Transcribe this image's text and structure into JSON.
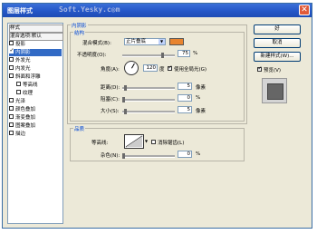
{
  "window": {
    "title": "图层样式",
    "watermark": "Soft.Yesky.c◎m",
    "close": "✕"
  },
  "left_panel": {
    "items": [
      {
        "label": "样式",
        "type": "header"
      },
      {
        "label": "混合选项:默认",
        "type": "header"
      },
      {
        "label": "投影",
        "checked": false
      },
      {
        "label": "内阴影",
        "checked": true,
        "selected": true
      },
      {
        "label": "外发光",
        "checked": false
      },
      {
        "label": "内发光",
        "checked": false
      },
      {
        "label": "斜面和浮雕",
        "checked": false
      },
      {
        "label": "等高线",
        "checked": false,
        "sub": true
      },
      {
        "label": "纹理",
        "checked": false,
        "sub": true
      },
      {
        "label": "光泽",
        "checked": false
      },
      {
        "label": "颜色叠加",
        "checked": false
      },
      {
        "label": "渐变叠加",
        "checked": false
      },
      {
        "label": "图案叠加",
        "checked": false
      },
      {
        "label": "描边",
        "checked": false
      }
    ]
  },
  "inner_shadow": {
    "section_title": "内阴影",
    "structure_title": "结构",
    "blend_mode_label": "混合模式(B):",
    "blend_mode_value": "正片叠底",
    "shadow_color": "#e8842f",
    "opacity_label": "不透明度(O):",
    "opacity_value": "75",
    "opacity_unit": "%",
    "angle_label": "角度(A):",
    "angle_value": "120",
    "angle_unit": "度",
    "global_light_label": "使用全局光(G)",
    "global_light_checked": true,
    "distance_label": "距离(D):",
    "distance_value": "5",
    "distance_unit": "像素",
    "choke_label": "阻塞(C):",
    "choke_value": "0",
    "choke_unit": "%",
    "size_label": "大小(S):",
    "size_value": "5",
    "size_unit": "像素"
  },
  "quality": {
    "title": "品质",
    "contour_label": "等高线:",
    "antialias_label": "消除锯齿(L)",
    "antialias_checked": false,
    "noise_label": "杂色(N):",
    "noise_value": "0",
    "noise_unit": "%"
  },
  "buttons": {
    "ok": "好",
    "cancel": "取消",
    "new_style": "新建样式(W)...",
    "preview_label": "预览(V)",
    "preview_checked": true
  }
}
